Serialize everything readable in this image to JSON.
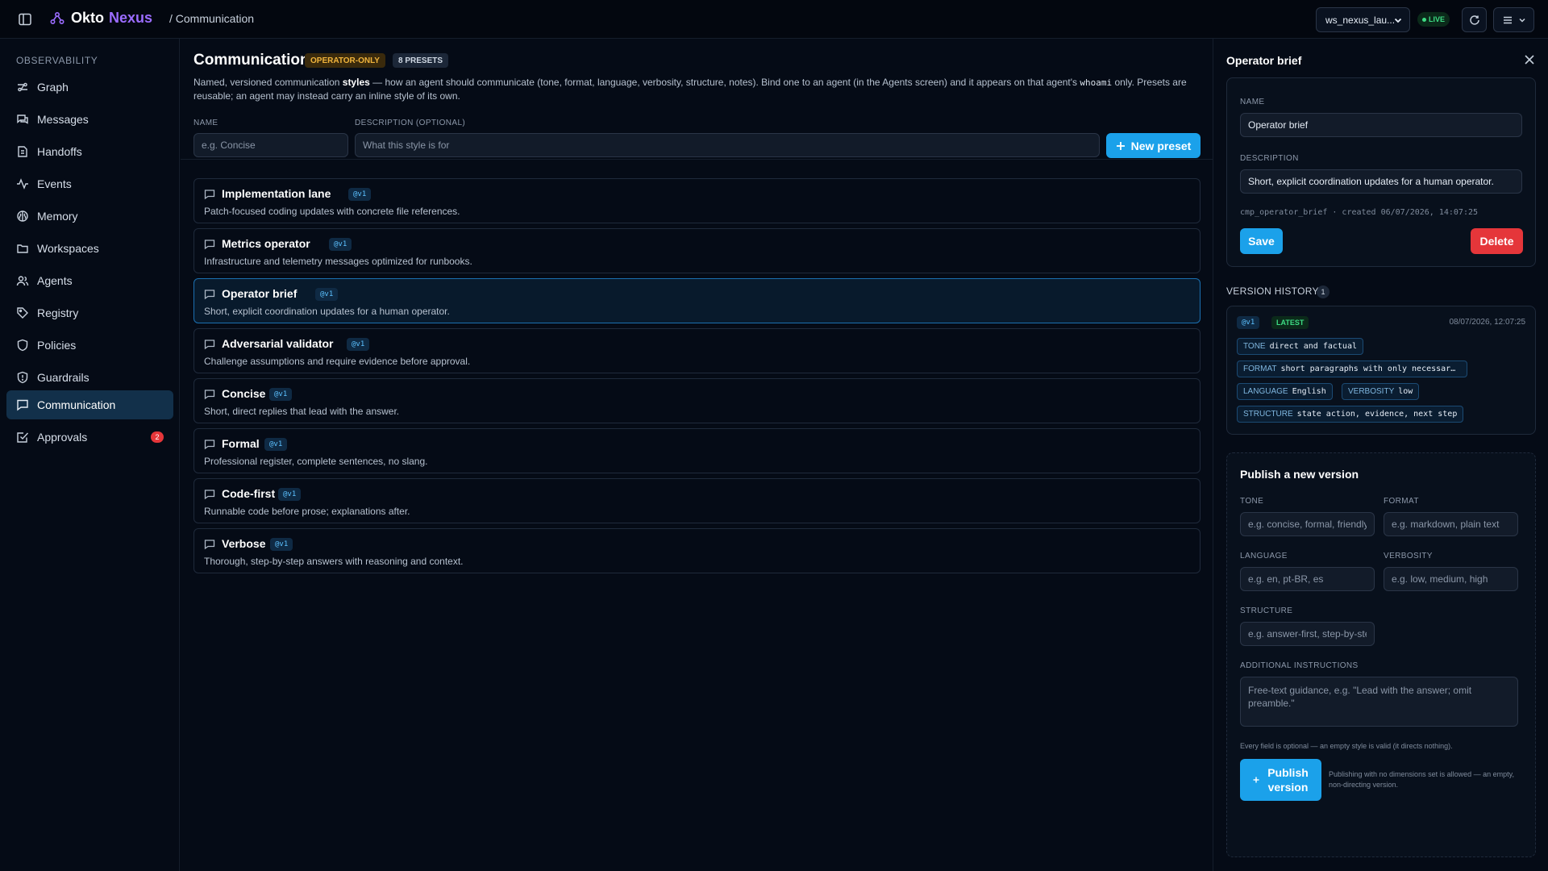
{
  "topbar": {
    "brand_primary": "Okto",
    "brand_secondary": "Nexus",
    "breadcrumb": "/ Communication",
    "workspace": "ws_nexus_lau...",
    "live_label": "LIVE",
    "accent": "#9b6cff"
  },
  "sidebar": {
    "section": "OBSERVABILITY",
    "items": [
      {
        "label": "Graph",
        "icon": "graph-icon"
      },
      {
        "label": "Messages",
        "icon": "messages-icon"
      },
      {
        "label": "Handoffs",
        "icon": "handoffs-icon"
      },
      {
        "label": "Events",
        "icon": "activity-icon"
      },
      {
        "label": "Memory",
        "icon": "brain-icon"
      },
      {
        "label": "Workspaces",
        "icon": "folder-icon"
      },
      {
        "label": "Agents",
        "icon": "users-icon"
      },
      {
        "label": "Registry",
        "icon": "tag-icon"
      },
      {
        "label": "Policies",
        "icon": "shield-icon"
      },
      {
        "label": "Guardrails",
        "icon": "shield-check-icon"
      },
      {
        "label": "Communication",
        "icon": "chat-icon",
        "active": true
      },
      {
        "label": "Approvals",
        "icon": "check-square-icon",
        "badge": "2"
      }
    ]
  },
  "main": {
    "title": "Communication",
    "tag_operator": "OPERATOR-ONLY",
    "tag_presets": "8 PRESETS",
    "description_pre": "Named, versioned communication ",
    "description_bold": "styles",
    "description_mid": " — how an agent should communicate (tone, format, language, verbosity, structure, notes). Bind one to an agent (in the Agents screen) and it appears on that agent's ",
    "description_code": "whoami",
    "description_post": " only. Presets are reusable; an agent may instead carry an inline style of its own.",
    "name_label": "NAME",
    "name_placeholder": "e.g. Concise",
    "desc_label": "DESCRIPTION (OPTIONAL)",
    "desc_placeholder": "What this style is for",
    "new_preset_label": "New preset",
    "presets": [
      {
        "name": "Implementation lane",
        "version": "@v1",
        "desc": "Patch-focused coding updates with concrete file references."
      },
      {
        "name": "Metrics operator",
        "version": "@v1",
        "desc": "Infrastructure and telemetry messages optimized for runbooks."
      },
      {
        "name": "Operator brief",
        "version": "@v1",
        "desc": "Short, explicit coordination updates for a human operator.",
        "selected": true
      },
      {
        "name": "Adversarial validator",
        "version": "@v1",
        "desc": "Challenge assumptions and require evidence before approval."
      },
      {
        "name": "Concise",
        "version": "@v1",
        "desc": "Short, direct replies that lead with the answer."
      },
      {
        "name": "Formal",
        "version": "@v1",
        "desc": "Professional register, complete sentences, no slang."
      },
      {
        "name": "Code-first",
        "version": "@v1",
        "desc": "Runnable code before prose; explanations after."
      },
      {
        "name": "Verbose",
        "version": "@v1",
        "desc": "Thorough, step-by-step answers with reasoning and context."
      }
    ]
  },
  "panel": {
    "title": "Operator brief",
    "name_label": "NAME",
    "name_value": "Operator brief",
    "description_label": "DESCRIPTION",
    "description_value": "Short, explicit coordination updates for a human operator.",
    "meta": "cmp_operator_brief · created 06/07/2026, 14:07:25",
    "save_label": "Save",
    "delete_label": "Delete",
    "history_title": "VERSION HISTORY",
    "history_count": "1",
    "version": {
      "tag": "@v1",
      "latest": "LATEST",
      "timestamp": "08/07/2026, 12:07:25",
      "tone_key": "TONE",
      "tone_val": "direct and factual",
      "format_key": "FORMAT",
      "format_val": "short paragraphs with only necessar…",
      "language_key": "LANGUAGE",
      "language_val": "English",
      "verbosity_key": "VERBOSITY",
      "verbosity_val": "low",
      "structure_key": "STRUCTURE",
      "structure_val": "state action, evidence, next step"
    },
    "publish": {
      "title": "Publish a new version",
      "tone_label": "TONE",
      "tone_placeholder": "e.g. concise, formal, friendly",
      "format_label": "FORMAT",
      "format_placeholder": "e.g. markdown, plain text",
      "language_label": "LANGUAGE",
      "language_placeholder": "e.g. en, pt-BR, es",
      "verbosity_label": "VERBOSITY",
      "verbosity_placeholder": "e.g. low, medium, high",
      "structure_label": "STRUCTURE",
      "structure_placeholder": "e.g. answer-first, step-by-step",
      "instructions_label": "ADDITIONAL INSTRUCTIONS",
      "instructions_placeholder": "Free-text guidance, e.g. \"Lead with the answer; omit preamble.\"",
      "optional_note": "Every field is optional — an empty style is valid (it directs nothing).",
      "publish_line1": "Publish",
      "publish_line2": "version",
      "publish_note": "Publishing with no dimensions set is allowed — an empty, non-directing version."
    }
  }
}
